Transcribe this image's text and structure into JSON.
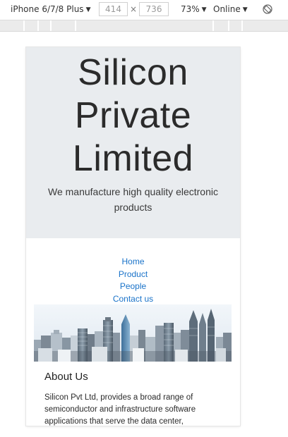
{
  "devtools": {
    "device": "iPhone 6/7/8 Plus",
    "width": "414",
    "height": "736",
    "zoom": "73%",
    "network": "Online"
  },
  "site": {
    "title": "Silicon Private Limited",
    "tagline": "We manufacture high quality electronic products",
    "nav": [
      "Home",
      "Product",
      "People",
      "Contact us"
    ],
    "about": {
      "heading": "About Us",
      "text": "Silicon Pvt Ltd, provides a broad range of semiconductor and infrastructure software applications that serve the data center,"
    }
  },
  "colors": {
    "jumbotron_bg": "#e9ecef",
    "link": "#1a73c9"
  }
}
